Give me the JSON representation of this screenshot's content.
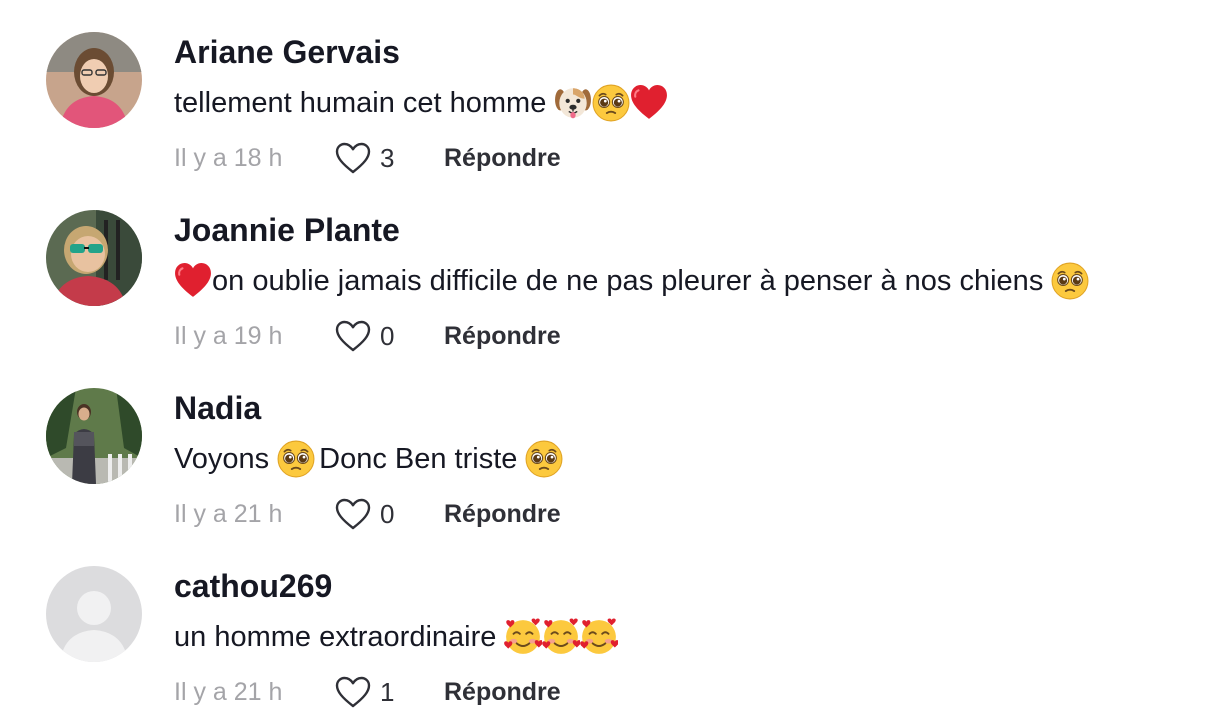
{
  "comments": [
    {
      "username": "Ariane Gervais",
      "text": [
        "tellement humain cet homme "
      ],
      "emojis": [
        "dog-face",
        "pleading-face",
        "red-heart"
      ],
      "timestamp": "Il y a 18 h",
      "likes": "3",
      "reply_label": "Répondre"
    },
    {
      "username": "Joannie Plante",
      "text": [
        "on oublie jamais difficile de ne pas pleurer à penser à nos chiens "
      ],
      "emojis": [
        "red-heart",
        "pleading-face"
      ],
      "timestamp": "Il y a 19 h",
      "likes": "0",
      "reply_label": "Répondre"
    },
    {
      "username": "Nadia",
      "text": [
        "Voyons ",
        " Donc Ben triste "
      ],
      "emojis": [
        "pleading-face",
        "pleading-face"
      ],
      "timestamp": "Il y a 21 h",
      "likes": "0",
      "reply_label": "Répondre"
    },
    {
      "username": "cathou269",
      "text": [
        "un homme extraordinaire "
      ],
      "emojis": [
        "smiling-face-with-hearts",
        "smiling-face-with-hearts",
        "smiling-face-with-hearts"
      ],
      "timestamp": "Il y a 21 h",
      "likes": "1",
      "reply_label": "Répondre"
    }
  ],
  "colors": {
    "text": "#161823",
    "muted": "#a4a4a8",
    "background": "#ffffff"
  },
  "icons": [
    "heart-outline-icon",
    "default-avatar-icon"
  ]
}
